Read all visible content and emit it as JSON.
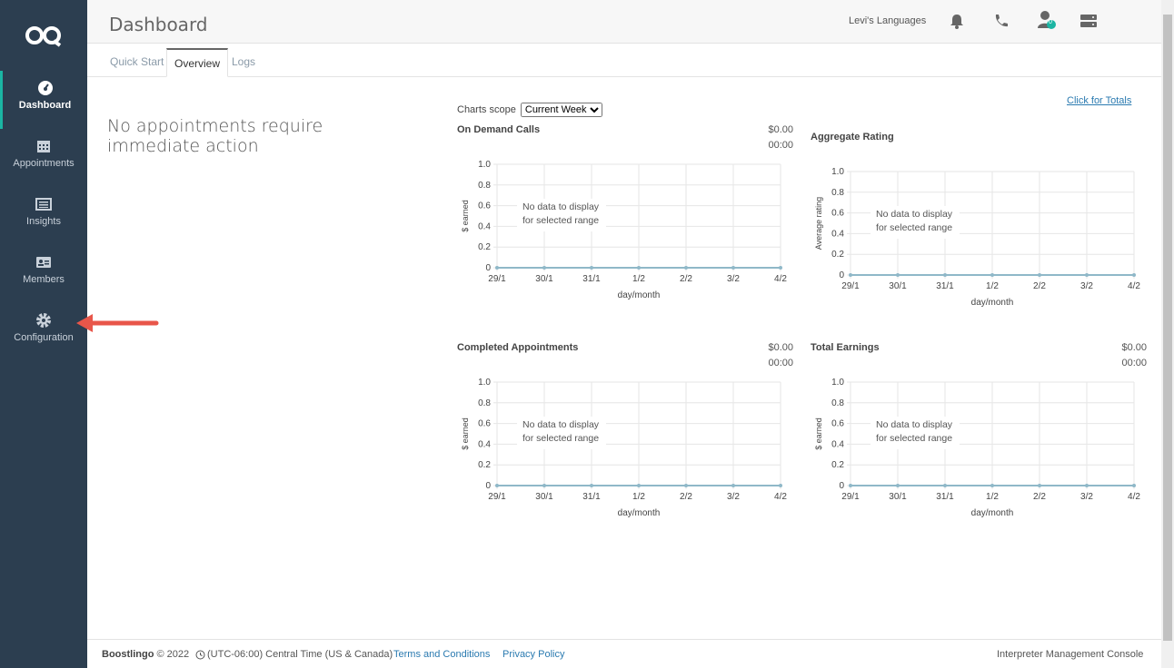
{
  "sidebar": {
    "items": [
      {
        "label": "Dashboard",
        "icon": "gauge-icon"
      },
      {
        "label": "Appointments",
        "icon": "calendar-icon"
      },
      {
        "label": "Insights",
        "icon": "list-icon"
      },
      {
        "label": "Members",
        "icon": "id-card-icon"
      },
      {
        "label": "Configuration",
        "icon": "gear-icon"
      }
    ]
  },
  "header": {
    "title": "Dashboard",
    "account": "Levi's Languages",
    "badge": "0"
  },
  "tabs": [
    "Quick Start",
    "Overview",
    "Logs"
  ],
  "main": {
    "notice": "No appointments require immediate action",
    "scope_label": "Charts scope",
    "scope_value": "Current Week",
    "totals_link": "Click for Totals"
  },
  "chart_data": [
    {
      "type": "line",
      "title": "On Demand Calls",
      "amount": "$0.00",
      "time": "00:00",
      "categories": [
        "29/1",
        "30/1",
        "31/1",
        "1/2",
        "2/2",
        "3/2",
        "4/2"
      ],
      "values": [
        0,
        0,
        0,
        0,
        0,
        0,
        0
      ],
      "ylim": [
        0,
        1.0
      ],
      "yticks": [
        "1.0",
        "0.8",
        "0.6",
        "0.4",
        "0.2",
        "0"
      ],
      "xlabel": "day/month",
      "ylabel": "$ earned",
      "empty_line1": "No data to display",
      "empty_line2": "for selected range"
    },
    {
      "type": "line",
      "title": "Aggregate Rating",
      "amount": "",
      "time": "",
      "categories": [
        "29/1",
        "30/1",
        "31/1",
        "1/2",
        "2/2",
        "3/2",
        "4/2"
      ],
      "values": [
        0,
        0,
        0,
        0,
        0,
        0,
        0
      ],
      "ylim": [
        0,
        1.0
      ],
      "yticks": [
        "1.0",
        "0.8",
        "0.6",
        "0.4",
        "0.2",
        "0"
      ],
      "xlabel": "day/month",
      "ylabel": "Average rating",
      "empty_line1": "No data to display",
      "empty_line2": "for selected range"
    },
    {
      "type": "line",
      "title": "Completed Appointments",
      "amount": "$0.00",
      "time": "00:00",
      "categories": [
        "29/1",
        "30/1",
        "31/1",
        "1/2",
        "2/2",
        "3/2",
        "4/2"
      ],
      "values": [
        0,
        0,
        0,
        0,
        0,
        0,
        0
      ],
      "ylim": [
        0,
        1.0
      ],
      "yticks": [
        "1.0",
        "0.8",
        "0.6",
        "0.4",
        "0.2",
        "0"
      ],
      "xlabel": "day/month",
      "ylabel": "$ earned",
      "empty_line1": "No data to display",
      "empty_line2": "for selected range"
    },
    {
      "type": "line",
      "title": "Total Earnings",
      "amount": "$0.00",
      "time": "00:00",
      "categories": [
        "29/1",
        "30/1",
        "31/1",
        "1/2",
        "2/2",
        "3/2",
        "4/2"
      ],
      "values": [
        0,
        0,
        0,
        0,
        0,
        0,
        0
      ],
      "ylim": [
        0,
        1.0
      ],
      "yticks": [
        "1.0",
        "0.8",
        "0.6",
        "0.4",
        "0.2",
        "0"
      ],
      "xlabel": "day/month",
      "ylabel": "$ earned",
      "empty_line1": "No data to display",
      "empty_line2": "for selected range"
    }
  ],
  "footer": {
    "brand": "Boostlingo",
    "copyright": "© 2022",
    "timezone": "(UTC-06:00) Central Time (US & Canada)",
    "terms": "Terms and Conditions",
    "privacy": "Privacy Policy",
    "console": "Interpreter Management Console"
  },
  "colors": {
    "sidebar": "#2c3e50",
    "accent": "#1bb5a3",
    "link": "#2a7ab0",
    "annotation_arrow": "#e8564a"
  }
}
